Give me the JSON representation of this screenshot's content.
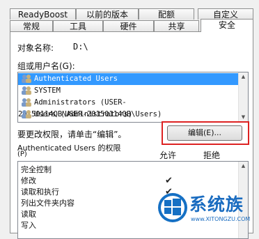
{
  "tabs_back": [
    "ReadyBoost",
    "以前的版本",
    "配额",
    "自定义"
  ],
  "tabs_front": [
    "常规",
    "工具",
    "硬件",
    "共享",
    "安全"
  ],
  "object_label": "对象名称:",
  "object_value": "D:\\",
  "group_label": "组或用户名(G):",
  "users": [
    "Authenticated Users",
    "SYSTEM",
    "Administrators (USER-20150114QB\\Administrators)",
    "Users (USER-20150114QB\\Users)"
  ],
  "change_hint": "要更改权限，请单击“编辑”。",
  "edit_button": "编辑(E)...",
  "permissions_label_1": "Authenticated Users 的权限",
  "permissions_label_2": "(P)",
  "allow_header": "允许",
  "deny_header": "拒绝",
  "permissions": [
    {
      "name": "完全控制",
      "allow": false
    },
    {
      "name": "修改",
      "allow": true
    },
    {
      "name": "读取和执行",
      "allow": true
    },
    {
      "name": "列出文件夹内容",
      "allow": true
    },
    {
      "name": "读取",
      "allow": true
    },
    {
      "name": "写入",
      "allow": true
    }
  ],
  "watermark": {
    "brand": "系统族",
    "url": "www.XITONGZU.COM"
  },
  "check_mark": "✔"
}
